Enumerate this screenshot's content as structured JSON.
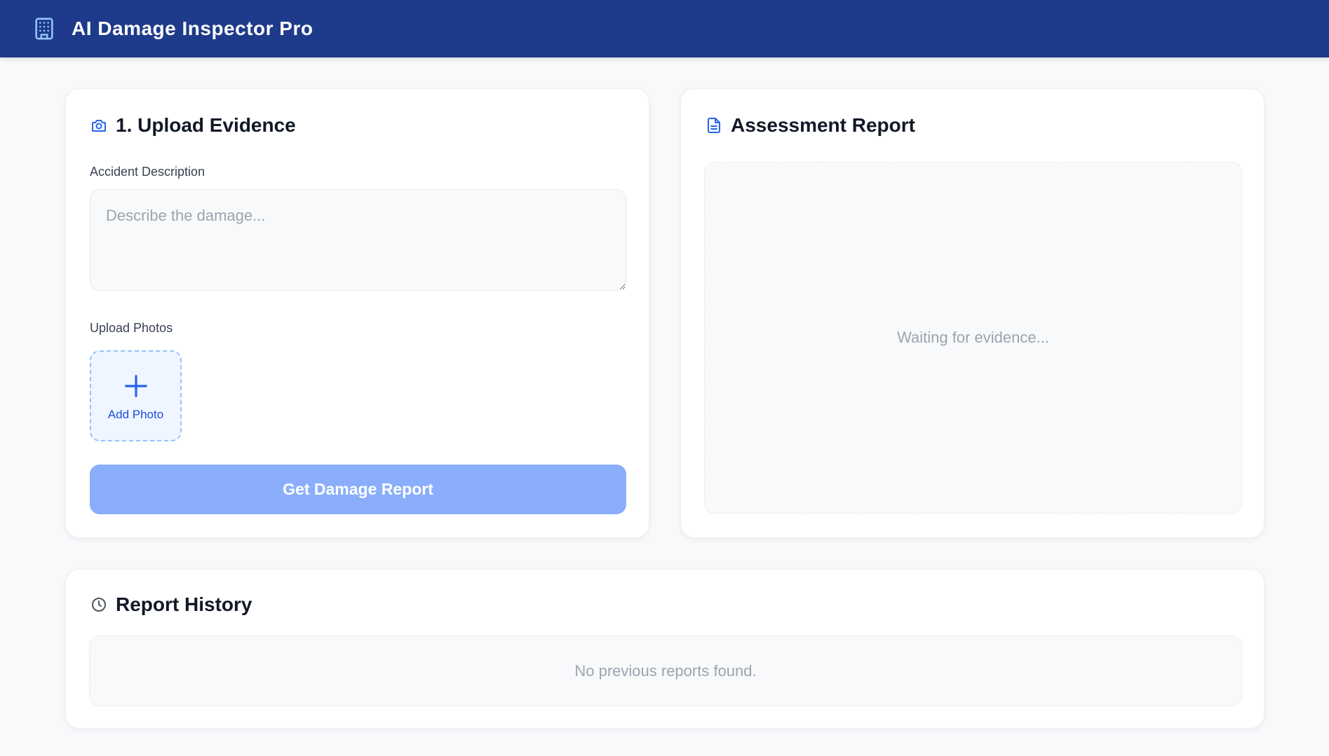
{
  "header": {
    "app_title": "AI Damage Inspector Pro",
    "logo_icon": "building-icon",
    "background_color": "#1e3a8a"
  },
  "upload_card": {
    "title": "1. Upload Evidence",
    "icon": "camera-icon",
    "description_label": "Accident Description",
    "description_value": "",
    "description_placeholder": "Describe the damage...",
    "photos_label": "Upload Photos",
    "add_photo_label": "Add Photo",
    "add_photo_icon": "plus-icon",
    "submit_label": "Get Damage Report",
    "submit_disabled": true,
    "accent_color": "#2563eb"
  },
  "report_card": {
    "title": "Assessment Report",
    "icon": "document-icon",
    "placeholder": "Waiting for evidence..."
  },
  "history_card": {
    "title": "Report History",
    "icon": "clock-icon",
    "empty_text": "No previous reports found."
  }
}
